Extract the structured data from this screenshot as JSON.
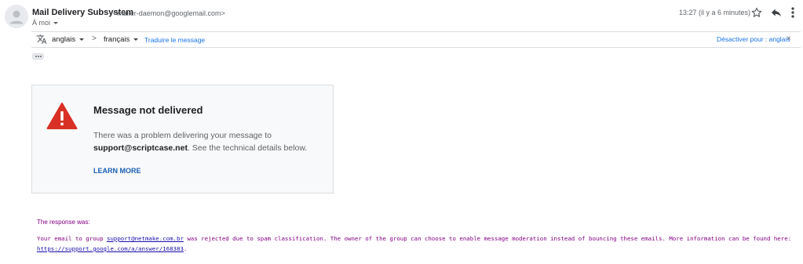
{
  "sender": {
    "name": "Mail Delivery Subsystem",
    "email": "<mailer-daemon@googlemail.com>",
    "to": "À moi"
  },
  "meta": {
    "timestamp": "13:27 (il y a 6 minutes)"
  },
  "icons": {
    "avatar": "person-avatar-icon",
    "star": "star-icon",
    "reply": "reply-icon",
    "more": "more-vert-icon",
    "translate": "translate-icon",
    "warning": "warning-triangle-icon"
  },
  "translate_bar": {
    "from_lang": "anglais",
    "arrow": ">",
    "to_lang": "français",
    "translate_link": "Traduire le message",
    "disable_label": "Désactiver pour : anglais",
    "close": "×"
  },
  "card": {
    "title": "Message not delivered",
    "body_intro": "There was a problem delivering your message to",
    "recipient": "support@scriptcase.net",
    "body_suffix": ". See the technical details below.",
    "learn_more": "LEARN MORE"
  },
  "response": {
    "label": "The response was:",
    "text_1": "Your email to group ",
    "group_link": "support@netmake.com.br",
    "text_2": " was rejected due to spam classification. The owner of the group can choose to enable message moderation instead of bouncing these emails. More information can be found here:",
    "help_link": "https://support.google.com/a/answer/168383",
    "text_3": "."
  },
  "colors": {
    "accent": "#1a73e8",
    "warning": "#d93025",
    "response_text": "#800080"
  }
}
